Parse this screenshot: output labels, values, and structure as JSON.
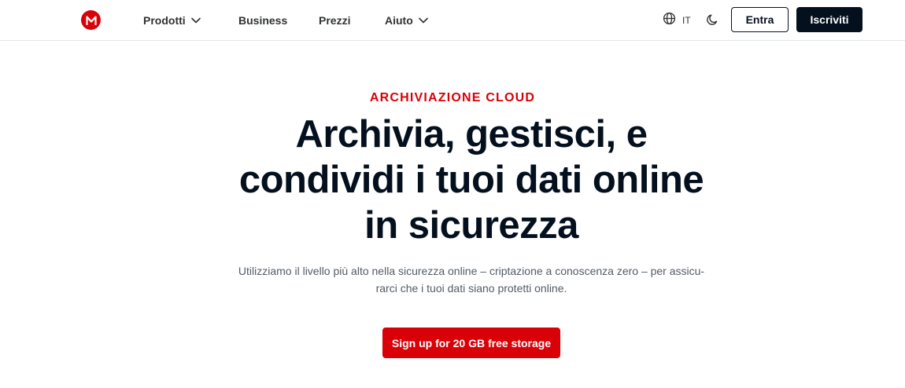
{
  "header": {
    "logo_icon": "mega-logo-icon",
    "nav": [
      {
        "label": "Prodotti",
        "has_dropdown": true
      },
      {
        "label": "Business",
        "has_dropdown": false
      },
      {
        "label": "Prezzi",
        "has_dropdown": false
      },
      {
        "label": "Aiuto",
        "has_dropdown": true
      }
    ],
    "language": {
      "icon": "globe-icon",
      "code": "IT"
    },
    "theme_icon": "moon-icon",
    "login_label": "Entra",
    "signup_label": "Iscriviti"
  },
  "hero": {
    "eyebrow": "ARCHIVIAZIONE CLOUD",
    "headline_lines": [
      "Archivia, gestisci, e",
      "condividi i tuoi dati online",
      "in sicurezza"
    ],
    "subtitle_lines": [
      "Utilizziamo il livello più alto nella sicurezza online – criptazione a conoscenza zero – per assicu-",
      "rarci che i tuoi dati siano protetti online."
    ],
    "cta_label": "Sign up for 20 GB free storage"
  },
  "colors": {
    "brand_red": "#d90007",
    "dark": "#04101e",
    "text_muted": "#535b65"
  }
}
